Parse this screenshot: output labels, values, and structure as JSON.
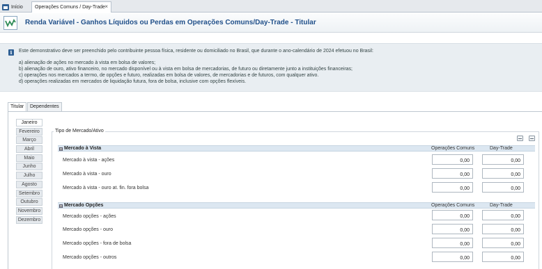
{
  "tabs": {
    "home": "Início",
    "active": "Operações Comuns / Day-Trade",
    "close": "×"
  },
  "header": {
    "title": "Renda Variável - Ganhos Líquidos ou Perdas em Operações Comuns/Day-Trade - Titular"
  },
  "info": {
    "intro": "Este demonstrativo deve ser preenchido pelo contribuinte pessoa física, residente ou domiciliado no Brasil, que durante o ano-calendário de 2024 efetuou no Brasil:",
    "items": [
      "a) alienação de ações no mercado à vista em bolsa de valores;",
      "b) alienação de ouro, ativo financeiro, no mercado disponível ou à vista em bolsa de mercadorias, de futuro ou diretamente junto a instituições financeiras;",
      "c) operações nos mercados a termo, de opções e futuro, realizadas em bolsa de valores, de mercadorias e de futuros, com qualquer ativo.",
      "d) operações realizadas em mercados de liquidação futura, fora de bolsa, inclusive com opções flexíveis."
    ]
  },
  "person_tabs": [
    "Titular",
    "Dependentes"
  ],
  "months": [
    "Janeiro",
    "Fevereiro",
    "Março",
    "Abril",
    "Maio",
    "Junho",
    "Julho",
    "Agosto",
    "Setembro",
    "Outubro",
    "Novembro",
    "Dezembro"
  ],
  "group_title": "Tipo de Mercado/Ativo",
  "icons": {
    "tool1": "copy-icon",
    "tool2": "clear-icon",
    "info": "info-icon"
  },
  "sections": [
    {
      "title": "Mercado à Vista",
      "col_common": "Operações Comuns",
      "col_daytrade": "Day-Trade",
      "rows": [
        {
          "label": "Mercado à vista - ações",
          "common": "0,00",
          "daytrade": "0,00"
        },
        {
          "label": "Mercado à vista - ouro",
          "common": "0,00",
          "daytrade": "0,00"
        },
        {
          "label": "Mercado à vista - ouro at. fin. fora bolsa",
          "common": "0,00",
          "daytrade": "0,00"
        }
      ]
    },
    {
      "title": "Mercado Opções",
      "col_common": "Operações Comuns",
      "col_daytrade": "Day-Trade",
      "rows": [
        {
          "label": "Mercado opções - ações",
          "common": "0,00",
          "daytrade": "0,00"
        },
        {
          "label": "Mercado opções - ouro",
          "common": "0,00",
          "daytrade": "0,00"
        },
        {
          "label": "Mercado opções - fora de bolsa",
          "common": "0,00",
          "daytrade": "0,00"
        },
        {
          "label": "Mercado opções - outros",
          "common": "0,00",
          "daytrade": "0,00"
        }
      ]
    }
  ]
}
